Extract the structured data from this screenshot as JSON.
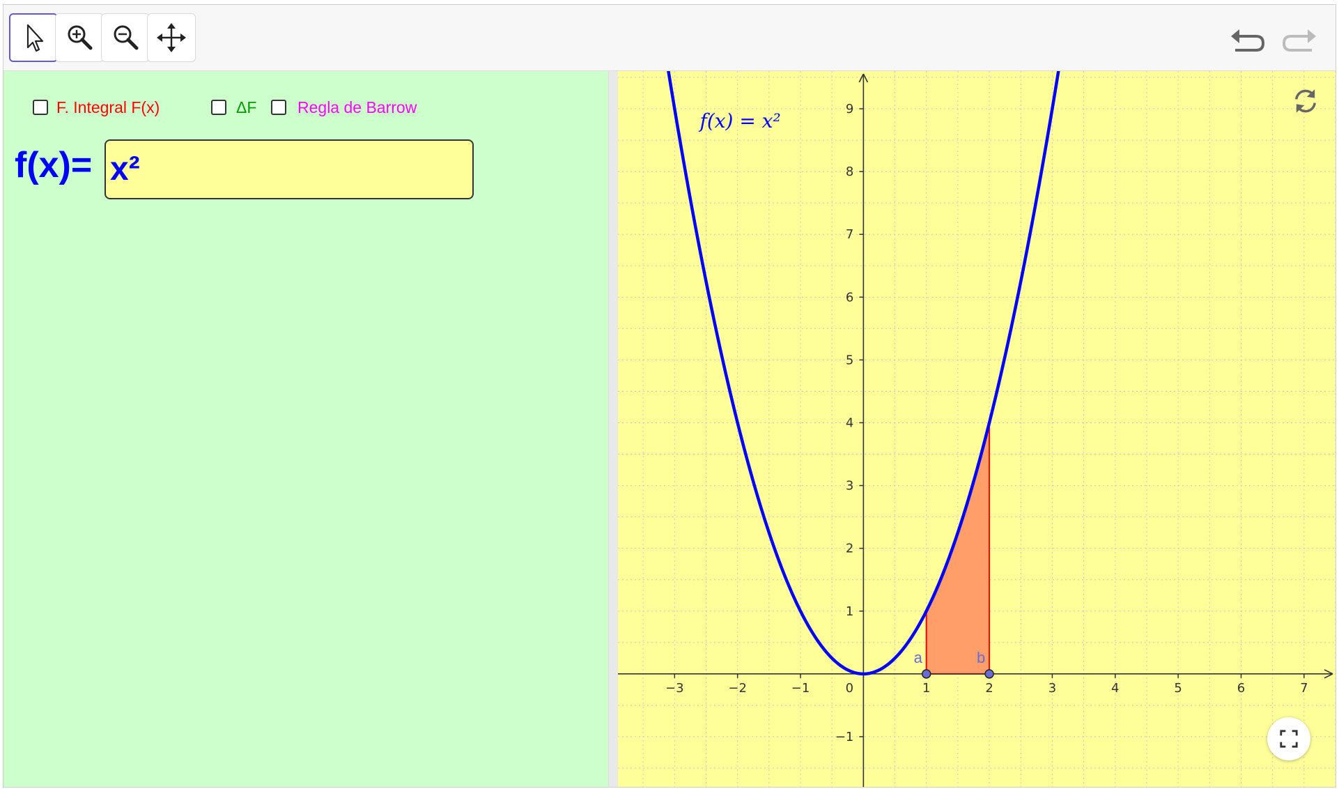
{
  "toolbar": {
    "tools": [
      {
        "name": "move",
        "icon": "arrow-pointer-icon",
        "selected": true
      },
      {
        "name": "zoom-in",
        "icon": "zoom-in-icon"
      },
      {
        "name": "zoom-out",
        "icon": "zoom-out-icon"
      },
      {
        "name": "move-graphics-view",
        "icon": "move-cross-icon"
      }
    ],
    "undo_icon": "undo-icon",
    "redo_icon": "redo-icon"
  },
  "algebra": {
    "checkboxes": [
      {
        "label": "F. Integral F(x)",
        "color": "#ff0000",
        "checked": false
      },
      {
        "label": "ΔF",
        "color": "#009900",
        "checked": false
      },
      {
        "label": "Regla de Barrow",
        "color": "#ff00ff",
        "checked": false
      }
    ],
    "input_label": "f(x)=",
    "input_value": "x²",
    "label_color": "#0000ff",
    "background": "#ccffcc"
  },
  "graphics": {
    "background": "#ffff99",
    "reset_icon": "reset-icon",
    "fullscreen_icon": "fullscreen-icon"
  },
  "chart_data": {
    "type": "line",
    "function_label": "f(x) = x²",
    "x_ticks": [
      "-3",
      "-2",
      "-1",
      "0",
      "1",
      "2",
      "3",
      "4",
      "5",
      "6",
      "7"
    ],
    "y_ticks": [
      "-1",
      "1",
      "2",
      "3",
      "4",
      "5",
      "6",
      "7",
      "8",
      "9"
    ],
    "xlim": [
      -3.9,
      7.5
    ],
    "ylim": [
      -1.8,
      9.6
    ],
    "grid": true,
    "curve_color": "#0000ff",
    "shade": {
      "from": 1,
      "to": 2,
      "color": "#ff9966",
      "edge": "#ff0000"
    },
    "points": [
      {
        "label": "a",
        "x": 1,
        "y": 0
      },
      {
        "label": "b",
        "x": 2,
        "y": 0
      }
    ]
  }
}
